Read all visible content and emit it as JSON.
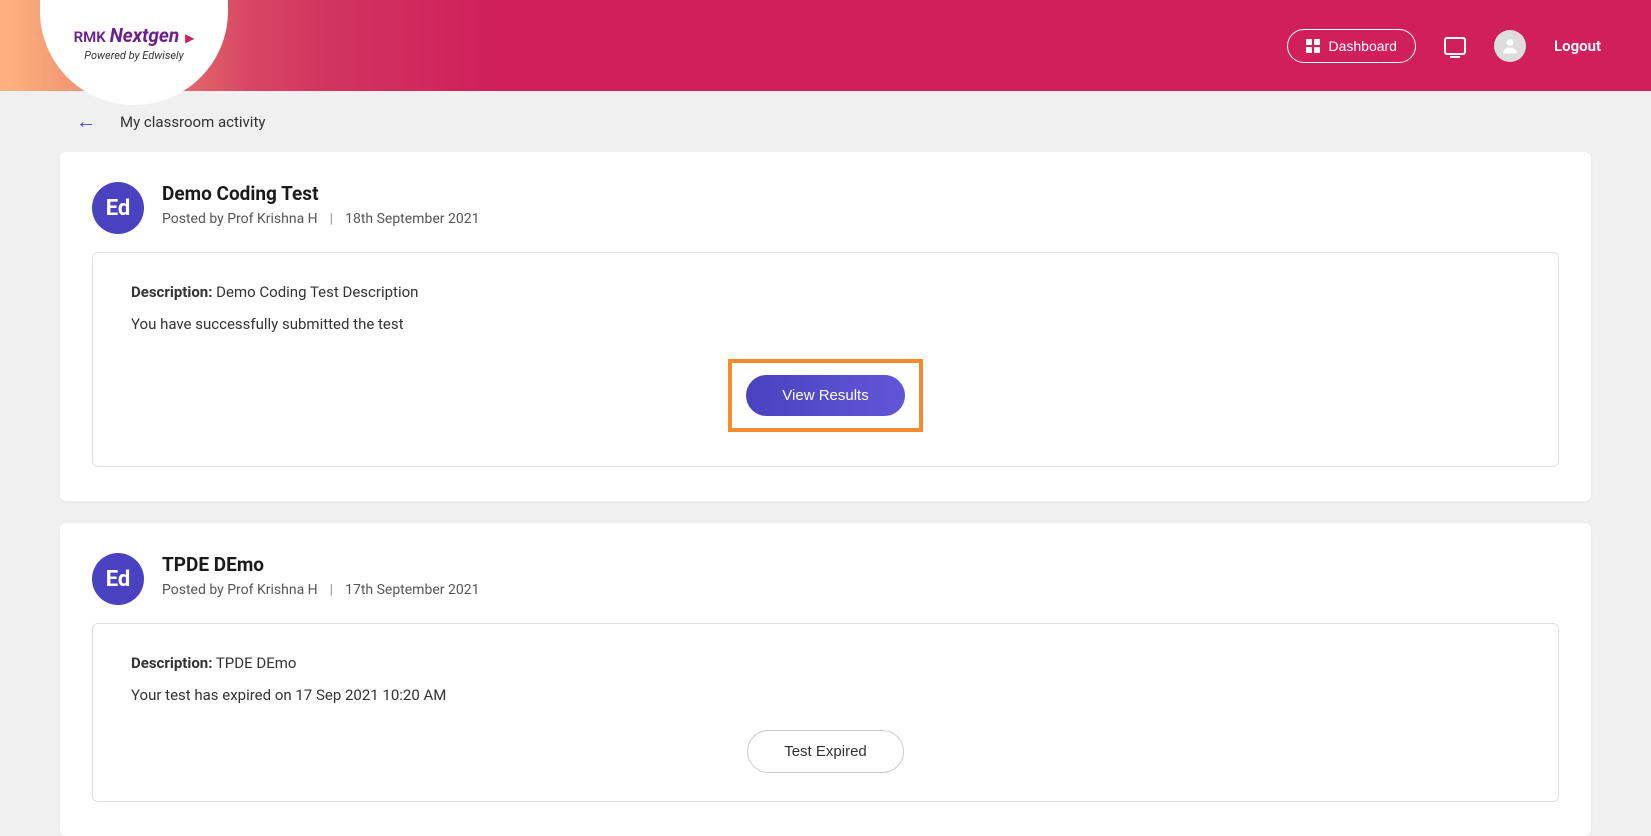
{
  "header": {
    "logo_rmk": "RMK",
    "logo_nextgen": "Nextgen",
    "logo_powered": "Powered by Edwisely",
    "dashboard_label": "Dashboard",
    "logout_label": "Logout"
  },
  "breadcrumb": {
    "title": "My classroom activity"
  },
  "cards": [
    {
      "badge": "Ed",
      "title": "Demo Coding Test",
      "posted_by": "Posted by Prof Krishna H",
      "date": "18th September 2021",
      "description_label": "Description:",
      "description_value": "Demo Coding Test Description",
      "status": "You have successfully submitted the test",
      "button_label": "View Results",
      "button_type": "primary",
      "highlighted": true
    },
    {
      "badge": "Ed",
      "title": "TPDE DEmo",
      "posted_by": "Posted by Prof Krishna H",
      "date": "17th September 2021",
      "description_label": "Description:",
      "description_value": "TPDE DEmo",
      "status": "Your test has expired on 17 Sep 2021 10:20 AM",
      "button_label": "Test Expired",
      "button_type": "disabled",
      "highlighted": false
    }
  ]
}
